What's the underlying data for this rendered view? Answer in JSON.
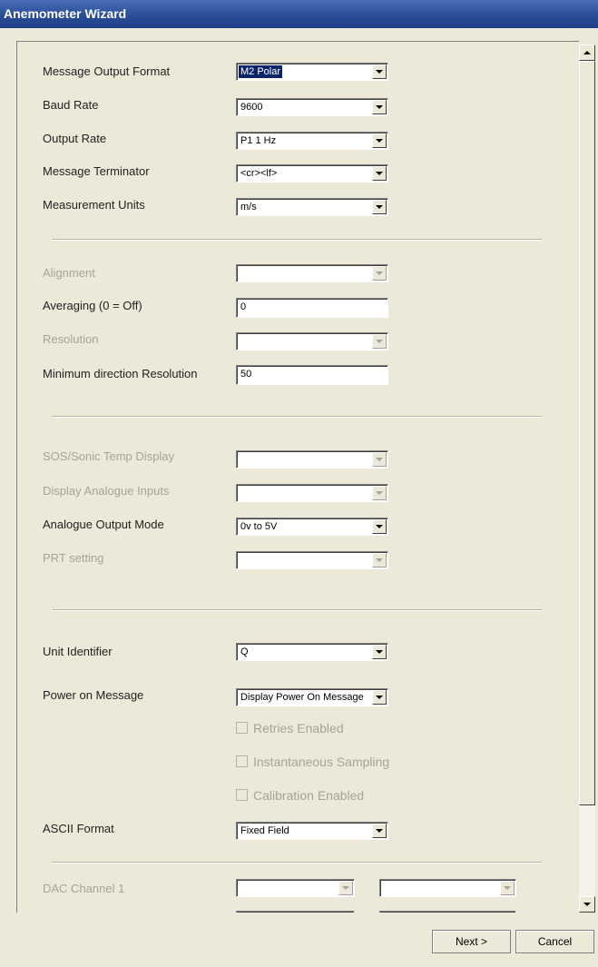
{
  "window": {
    "title": "Anemometer Wizard"
  },
  "fields": {
    "message_output_format": {
      "label": "Message Output Format",
      "value": "M2 Polar"
    },
    "baud_rate": {
      "label": "Baud Rate",
      "value": "9600"
    },
    "output_rate": {
      "label": "Output Rate",
      "value": "P1 1 Hz"
    },
    "message_terminator": {
      "label": "Message Terminator",
      "value": "<cr><lf>"
    },
    "measurement_units": {
      "label": "Measurement Units",
      "value": "m/s"
    },
    "alignment": {
      "label": "Alignment",
      "value": ""
    },
    "averaging": {
      "label": "Averaging (0 = Off)",
      "value": "0"
    },
    "resolution": {
      "label": "Resolution",
      "value": ""
    },
    "min_direction_resolution": {
      "label": "Minimum direction Resolution",
      "value": "50"
    },
    "sos_display": {
      "label": "SOS/Sonic Temp Display",
      "value": ""
    },
    "display_analogue_inputs": {
      "label": "Display Analogue Inputs",
      "value": ""
    },
    "analogue_output_mode": {
      "label": "Analogue Output  Mode",
      "value": "0v to 5V"
    },
    "prt_setting": {
      "label": "PRT setting",
      "value": ""
    },
    "unit_identifier": {
      "label": "Unit Identifier",
      "value": "Q"
    },
    "power_on_message": {
      "label": "Power on Message",
      "value": "Display Power On Message"
    },
    "ascii_format": {
      "label": "ASCII Format",
      "value": "Fixed Field"
    },
    "dac_channel_1": {
      "label": "DAC Channel 1",
      "value_a": "",
      "value_b": ""
    }
  },
  "checks": {
    "retries": "Retries Enabled",
    "instantaneous": "Instantaneous Sampling",
    "calibration": "Calibration Enabled"
  },
  "buttons": {
    "next": "Next >",
    "cancel": "Cancel"
  }
}
